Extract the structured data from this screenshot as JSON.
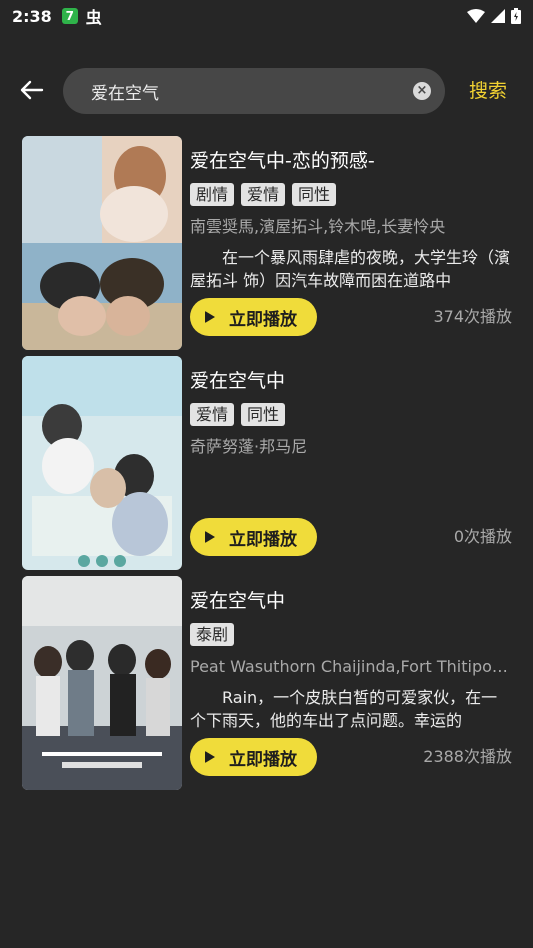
{
  "status_bar": {
    "time": "2:38",
    "app_badge": "7",
    "icons": [
      "app-badge-icon",
      "bug-icon",
      "wifi-icon",
      "signal-icon",
      "battery-icon"
    ]
  },
  "search": {
    "query": "爱在空气",
    "button_label": "搜索"
  },
  "results": [
    {
      "title": "爱在空气中-恋的预感-",
      "tags": [
        "剧情",
        "爱情",
        "同性"
      ],
      "actors": "南雲奨馬,濱屋拓斗,铃木唣,长妻怜央",
      "description": "在一个暴风雨肆虐的夜晚，大学生玲（濱屋拓斗 饰）因汽车故障而困在道路中",
      "play_label": "立即播放",
      "play_count": "374次播放"
    },
    {
      "title": "爱在空气中",
      "tags": [
        "爱情",
        "同性"
      ],
      "actors": "奇萨努蓬·邦马尼",
      "description": "",
      "play_label": "立即播放",
      "play_count": "0次播放"
    },
    {
      "title": "爱在空气中",
      "tags": [
        "泰剧"
      ],
      "actors": "Peat Wasuthorn Chaijinda,Fort Thitipong Sengngai",
      "description": "Rain，一个皮肤白皙的可爱家伙，在一个下雨天，他的车出了点问题。幸运的",
      "play_label": "立即播放",
      "play_count": "2388次播放"
    }
  ],
  "colors": {
    "background": "#262626",
    "accent": "#f0dc3a",
    "search_box": "#474747"
  }
}
